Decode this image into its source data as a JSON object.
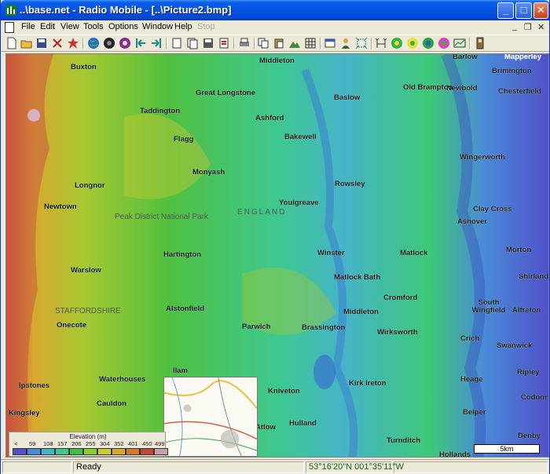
{
  "window": {
    "title": "..\\base.net - Radio Mobile - [..\\Picture2.bmp]",
    "controls": {
      "minimize": "_",
      "maximize": "□",
      "close": "✕"
    }
  },
  "menu": {
    "items": [
      {
        "label": "File",
        "enabled": true
      },
      {
        "label": "Edit",
        "enabled": true
      },
      {
        "label": "View",
        "enabled": true
      },
      {
        "label": "Tools",
        "enabled": true
      },
      {
        "label": "Options",
        "enabled": true
      },
      {
        "label": "Window",
        "enabled": true
      },
      {
        "label": "Help",
        "enabled": true
      },
      {
        "label": "Stop",
        "enabled": false
      }
    ],
    "mdi_controls": {
      "minimize": "_",
      "restore": "❐",
      "close": "✕"
    }
  },
  "toolbar": {
    "icons": [
      "new-icon",
      "open-icon",
      "save-icon",
      "tool-x-icon",
      "tool-star-icon",
      "globe-icon",
      "globe-dark-icon",
      "globe-color-icon",
      "arrow-left-icon",
      "arrow-right-icon",
      "page-icon",
      "page-copy-icon",
      "page-save-icon",
      "pdf-icon",
      "print-icon",
      "copy-icon",
      "paste-icon",
      "landscape-icon",
      "grid-icon",
      "window-icon",
      "person-icon",
      "select-icon",
      "antenna-icon",
      "radio-green-icon",
      "radio-yellow-icon",
      "radio-blue-icon",
      "radio-pink-icon",
      "chart-icon",
      "device-icon"
    ]
  },
  "map": {
    "region_labels": [
      "ENGLAND",
      "Peak District National Park",
      "STAFFORDSHIRE"
    ],
    "places": [
      {
        "name": "Buxton"
      },
      {
        "name": "Middleton"
      },
      {
        "name": "Baslow"
      },
      {
        "name": "Great Longstone"
      },
      {
        "name": "Taddington"
      },
      {
        "name": "Ashford"
      },
      {
        "name": "Old Brampton"
      },
      {
        "name": "Newbold"
      },
      {
        "name": "Brimington"
      },
      {
        "name": "Chesterfield"
      },
      {
        "name": "Barlow"
      },
      {
        "name": "Flagg"
      },
      {
        "name": "Bakewell"
      },
      {
        "name": "Wingerworth"
      },
      {
        "name": "Monyash"
      },
      {
        "name": "Longnor"
      },
      {
        "name": "Rowsley"
      },
      {
        "name": "Youlgreave"
      },
      {
        "name": "Newtown"
      },
      {
        "name": "Clay Cross"
      },
      {
        "name": "Ashover"
      },
      {
        "name": "Hartington"
      },
      {
        "name": "Winster"
      },
      {
        "name": "Matlock"
      },
      {
        "name": "Morton"
      },
      {
        "name": "Warslow"
      },
      {
        "name": "Matlock Bath"
      },
      {
        "name": "Shirland"
      },
      {
        "name": "Cromford"
      },
      {
        "name": "Alstonfield"
      },
      {
        "name": "Middleton"
      },
      {
        "name": "South Wingfield"
      },
      {
        "name": "Alfreton"
      },
      {
        "name": "Onecote"
      },
      {
        "name": "Parwich"
      },
      {
        "name": "Brassington"
      },
      {
        "name": "Wirksworth"
      },
      {
        "name": "Crich"
      },
      {
        "name": "Swanwick"
      },
      {
        "name": "Ilam"
      },
      {
        "name": "Waterhouses"
      },
      {
        "name": "Kniveton"
      },
      {
        "name": "Kirk Ireton"
      },
      {
        "name": "Heage"
      },
      {
        "name": "Ipstones"
      },
      {
        "name": "Cauldon"
      },
      {
        "name": "Belper"
      },
      {
        "name": "Codnor"
      },
      {
        "name": "Hulland"
      },
      {
        "name": "Kingsley"
      },
      {
        "name": "Turnditch"
      },
      {
        "name": "Denby"
      },
      {
        "name": "Hollands"
      },
      {
        "name": "Ripley"
      },
      {
        "name": "Atlow"
      },
      {
        "name": "Mapperley"
      }
    ],
    "scalebar_label": "5km"
  },
  "legend": {
    "title": "Elevation (m)",
    "labels": [
      "<",
      "59",
      "108",
      "157",
      "206",
      "255",
      "304",
      "352",
      "401",
      "450",
      "499"
    ],
    "colors": [
      "#5050c8",
      "#4a8ad8",
      "#46b4c8",
      "#3ec890",
      "#3cc04a",
      "#8ccc30",
      "#c8d030",
      "#d8a830",
      "#d07a30",
      "#c04a38",
      "#c8a0a8"
    ]
  },
  "status": {
    "ready": "Ready",
    "coords": "53°16'20\"N 001°35'11\"W"
  }
}
